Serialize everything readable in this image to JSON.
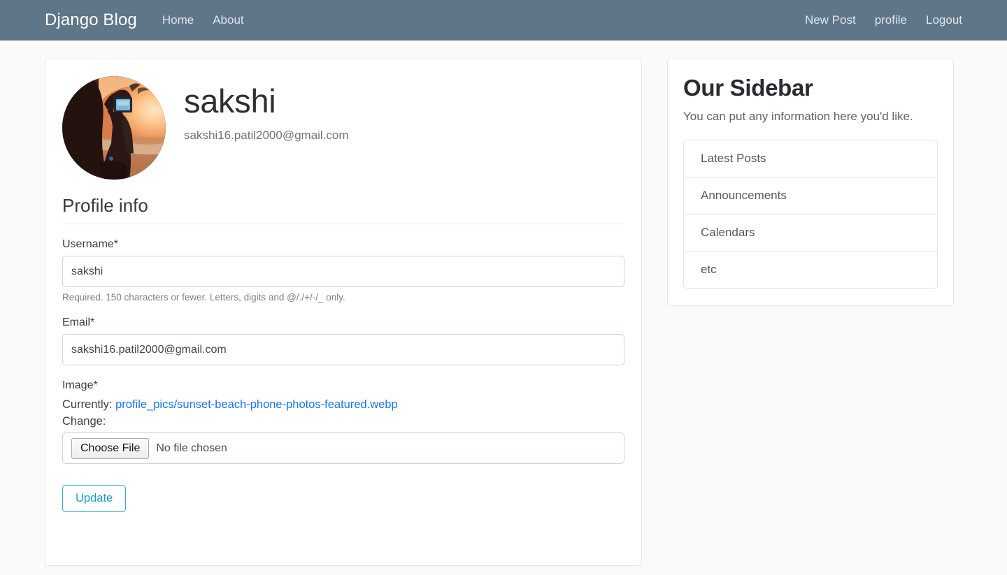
{
  "navbar": {
    "brand": "Django Blog",
    "left_links": [
      {
        "label": "Home",
        "name": "nav-link-home"
      },
      {
        "label": "About",
        "name": "nav-link-about"
      }
    ],
    "right_links": [
      {
        "label": "New Post",
        "name": "nav-link-new-post"
      },
      {
        "label": "profile",
        "name": "nav-link-profile"
      },
      {
        "label": "Logout",
        "name": "nav-link-logout"
      }
    ],
    "background_color": "#5f7689",
    "text_color": "#dfe5ea"
  },
  "profile": {
    "avatar_alt": "profile-avatar-sunset-beach-photo",
    "username": "sakshi",
    "email": "sakshi16.patil2000@gmail.com"
  },
  "form": {
    "legend": "Profile info",
    "username_field": {
      "label": "Username*",
      "value": "sakshi",
      "help": "Required. 150 characters or fewer. Letters, digits and @/./+/-/_ only."
    },
    "email_field": {
      "label": "Email*",
      "value": "sakshi16.patil2000@gmail.com"
    },
    "image_field": {
      "label": "Image*",
      "currently_label": "Currently:",
      "currently_file": "profile_pics/sunset-beach-phone-photos-featured.webp",
      "change_label": "Change:",
      "choose_file_button": "Choose File",
      "file_status": "No file chosen"
    },
    "submit_label": "Update",
    "submit_color": "#38a9d6"
  },
  "sidebar": {
    "title": "Our Sidebar",
    "description": "You can put any information here you'd like.",
    "items": [
      {
        "label": "Latest Posts"
      },
      {
        "label": "Announcements"
      },
      {
        "label": "Calendars"
      },
      {
        "label": "etc"
      }
    ]
  }
}
